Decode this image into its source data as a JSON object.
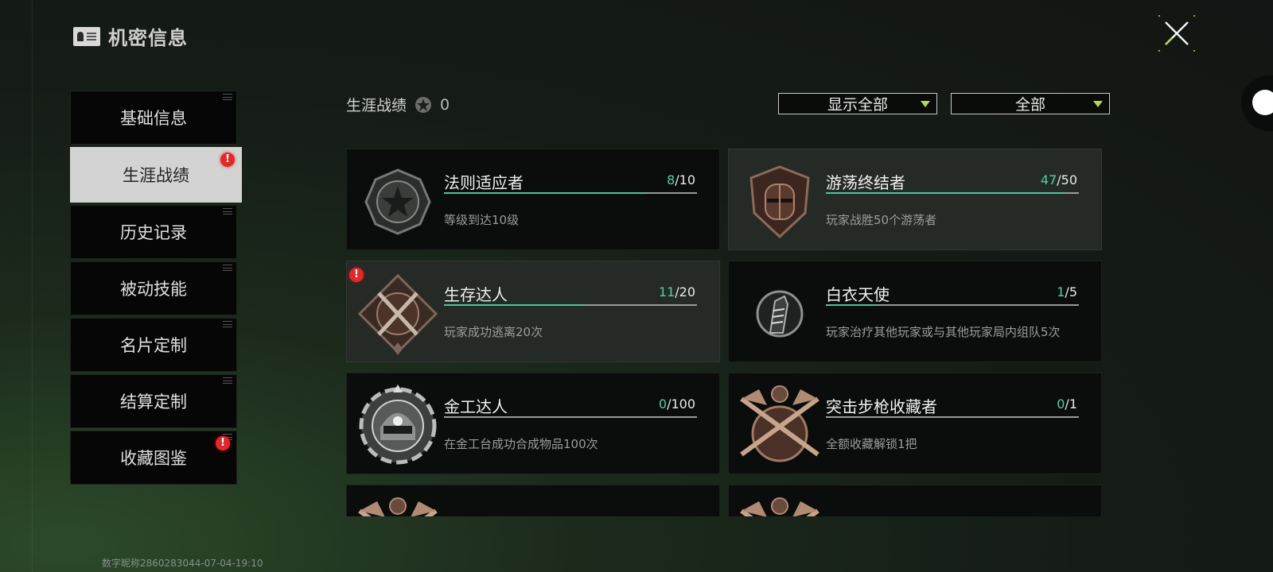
{
  "header": {
    "title": "机密信息",
    "icon": "id-card-icon"
  },
  "sidebar": {
    "items": [
      {
        "label": "基础信息",
        "active": false,
        "alert": false
      },
      {
        "label": "生涯战绩",
        "active": true,
        "alert": true
      },
      {
        "label": "历史记录",
        "active": false,
        "alert": false
      },
      {
        "label": "被动技能",
        "active": false,
        "alert": false
      },
      {
        "label": "名片定制",
        "active": false,
        "alert": false
      },
      {
        "label": "结算定制",
        "active": false,
        "alert": false
      },
      {
        "label": "收藏图鉴",
        "active": false,
        "alert": true
      }
    ],
    "alert_symbol": "!"
  },
  "section": {
    "title": "生涯战绩",
    "medal_count": "0",
    "medal_icon": "medal-star-icon"
  },
  "filters": {
    "show": {
      "value": "显示全部"
    },
    "category": {
      "value": "全部"
    }
  },
  "achievements": [
    {
      "name": "法则适应者",
      "current": "8",
      "total": "10",
      "progress": 0.8,
      "desc": "等级到达10级",
      "emblem": "star-octagon-emblem",
      "highlight": false,
      "alert": false
    },
    {
      "name": "游荡终结者",
      "current": "47",
      "total": "50",
      "progress": 0.94,
      "desc": "玩家战胜50个游荡者",
      "emblem": "knight-helmet-emblem",
      "highlight": true,
      "alert": false
    },
    {
      "name": "生存达人",
      "current": "11",
      "total": "20",
      "progress": 0.55,
      "desc": "玩家成功逃离20次",
      "emblem": "crossed-knives-emblem",
      "highlight": true,
      "alert": true
    },
    {
      "name": "白衣天使",
      "current": "1",
      "total": "5",
      "progress": 0.2,
      "desc": "玩家治疗其他玩家或与其他玩家局内组队5次",
      "emblem": "bandage-arm-emblem",
      "highlight": false,
      "alert": false
    },
    {
      "name": "金工达人",
      "current": "0",
      "total": "100",
      "progress": 0,
      "desc": "在金工台成功合成物品100次",
      "emblem": "helmet-gear-emblem",
      "highlight": false,
      "alert": false
    },
    {
      "name": "突击步枪收藏者",
      "current": "0",
      "total": "1",
      "progress": 0,
      "desc": "全额收藏解锁1把",
      "emblem": "crossed-rifles-emblem",
      "highlight": false,
      "alert": false
    },
    {
      "name": "",
      "current": "",
      "total": "",
      "progress": 0,
      "desc": "",
      "emblem": "crossed-rifles-emblem",
      "highlight": false,
      "alert": false
    },
    {
      "name": "",
      "current": "",
      "total": "",
      "progress": 0,
      "desc": "",
      "emblem": "crossed-rifles-emblem",
      "highlight": false,
      "alert": false
    }
  ],
  "footer": {
    "watermark": "数字昵称2860283044-07-04-19:10"
  },
  "colors": {
    "accent": "#45c6a0",
    "alert": "#e02a2a",
    "caret": "#b5d94c"
  }
}
